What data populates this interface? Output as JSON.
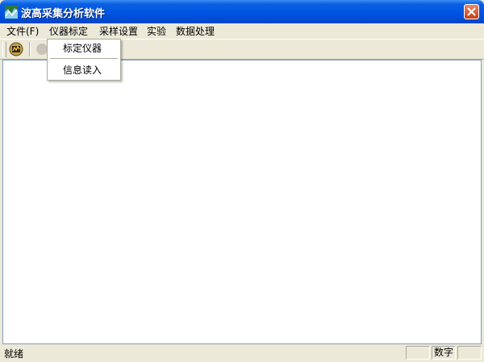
{
  "window": {
    "title": "波高采集分析软件",
    "app_icon": "app-icon",
    "close_icon": "close-icon"
  },
  "menu": {
    "items": [
      {
        "label": "文件(F)"
      },
      {
        "label": "仪器标定"
      },
      {
        "label": "采样设置"
      },
      {
        "label": "实验"
      },
      {
        "label": "数据处理"
      }
    ],
    "open_index": 1,
    "dropdown": [
      {
        "label": "标定仪器"
      },
      {
        "label": "信息读入"
      }
    ]
  },
  "toolbar": {
    "buttons": [
      {
        "icon": "instrument-icon"
      },
      {
        "icon": "disabled-icon"
      }
    ]
  },
  "status": {
    "text": "就绪",
    "panes": [
      "",
      "数字",
      ""
    ]
  }
}
